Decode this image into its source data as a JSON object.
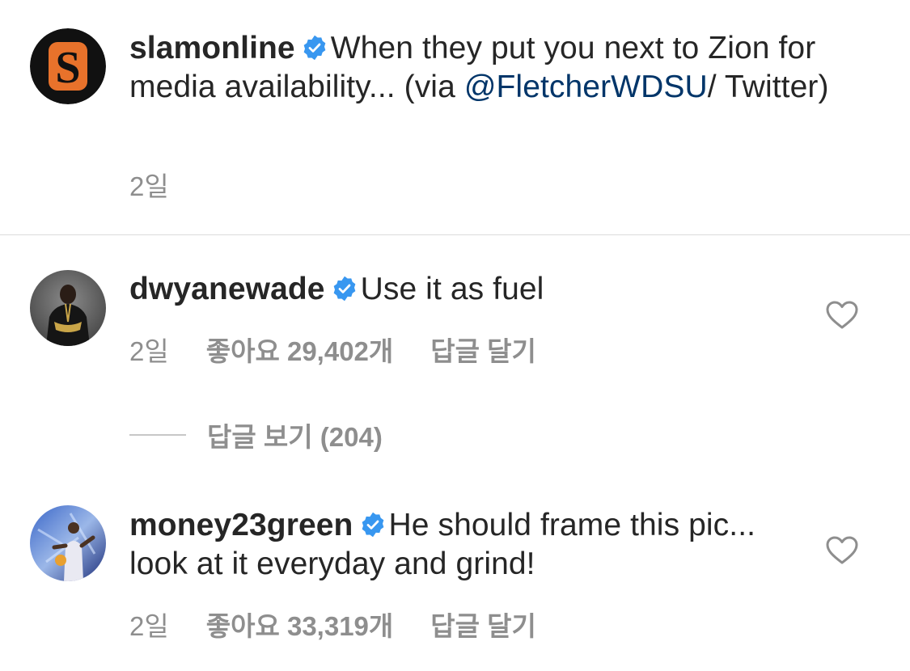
{
  "caption": {
    "username": "slamonline",
    "text_before": "When they put you next to Zion for media availability... (via ",
    "mention": "@FletcherWDSU",
    "text_after": "/ Twitter)",
    "time": "2일",
    "avatar_letter": "S"
  },
  "comments": [
    {
      "username": "dwyanewade",
      "text": "Use it as fuel",
      "time": "2일",
      "likes": "좋아요 29,402개",
      "reply_label": "답글 달기",
      "view_replies": "답글 보기 (204)"
    },
    {
      "username": "money23green",
      "text": "He should frame this pic... look at it everyday and grind!",
      "time": "2일",
      "likes": "좋아요 33,319개",
      "reply_label": "답글 달기"
    }
  ],
  "colors": {
    "text": "#262626",
    "muted": "#8e8e8e",
    "mention": "#003569",
    "verified": "#3897f0",
    "slam_orange": "#e8722b"
  },
  "icons": {
    "verified": "verified-badge-icon",
    "like": "heart-outline-icon"
  }
}
